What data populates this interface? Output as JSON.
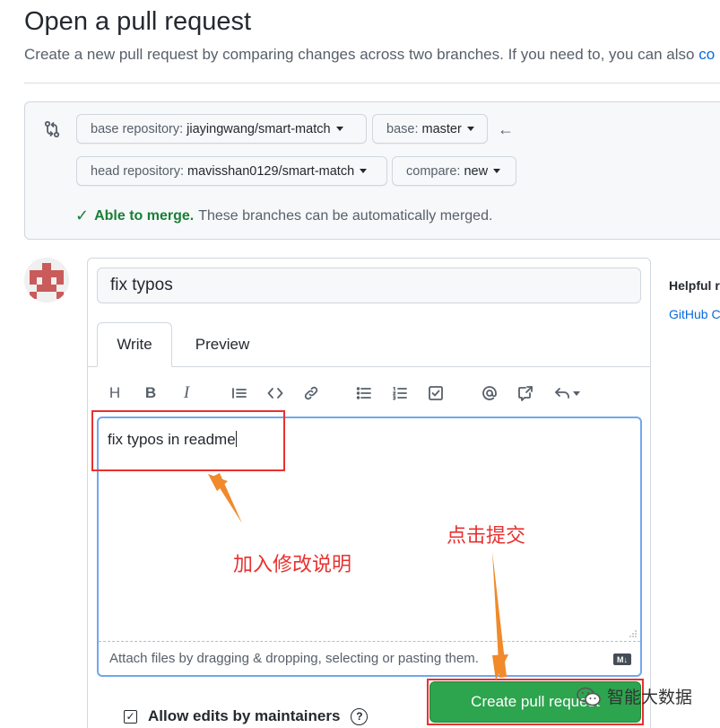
{
  "header": {
    "title": "Open a pull request",
    "subtitle": "Create a new pull request by comparing changes across two branches. If you need to, you can also ",
    "subtitle_link": "co"
  },
  "compare": {
    "base_repo_label": "base repository:",
    "base_repo_value": "jiayingwang/smart-match",
    "base_label": "base:",
    "base_value": "master",
    "head_repo_label": "head repository:",
    "head_repo_value": "mavisshan0129/smart-match",
    "compare_label": "compare:",
    "compare_value": "new",
    "merge_ok": "Able to merge.",
    "merge_msg": "These branches can be automatically merged."
  },
  "form": {
    "title_value": "fix typos",
    "tabs": [
      {
        "label": "Write"
      },
      {
        "label": "Preview"
      }
    ],
    "toolbar": {
      "heading": "H",
      "bold": "B",
      "italic": "I"
    },
    "body_text": "fix typos in readme",
    "attach_text": "Attach files by dragging & dropping, selecting or pasting them.",
    "md_badge": "M↓",
    "allow_edits": "Allow edits by maintainers",
    "help": "?",
    "submit_label": "Create pull request"
  },
  "sidebar": {
    "title": "Helpful r",
    "link": "GitHub C"
  },
  "annotations": {
    "describe": "加入修改说明",
    "submit": "点击提交",
    "accent": "#e8312f"
  },
  "watermark": {
    "text": "智能大数据"
  },
  "colors": {
    "primary_button": "#2da44e",
    "success": "#1a7f37",
    "link": "#0969da"
  }
}
